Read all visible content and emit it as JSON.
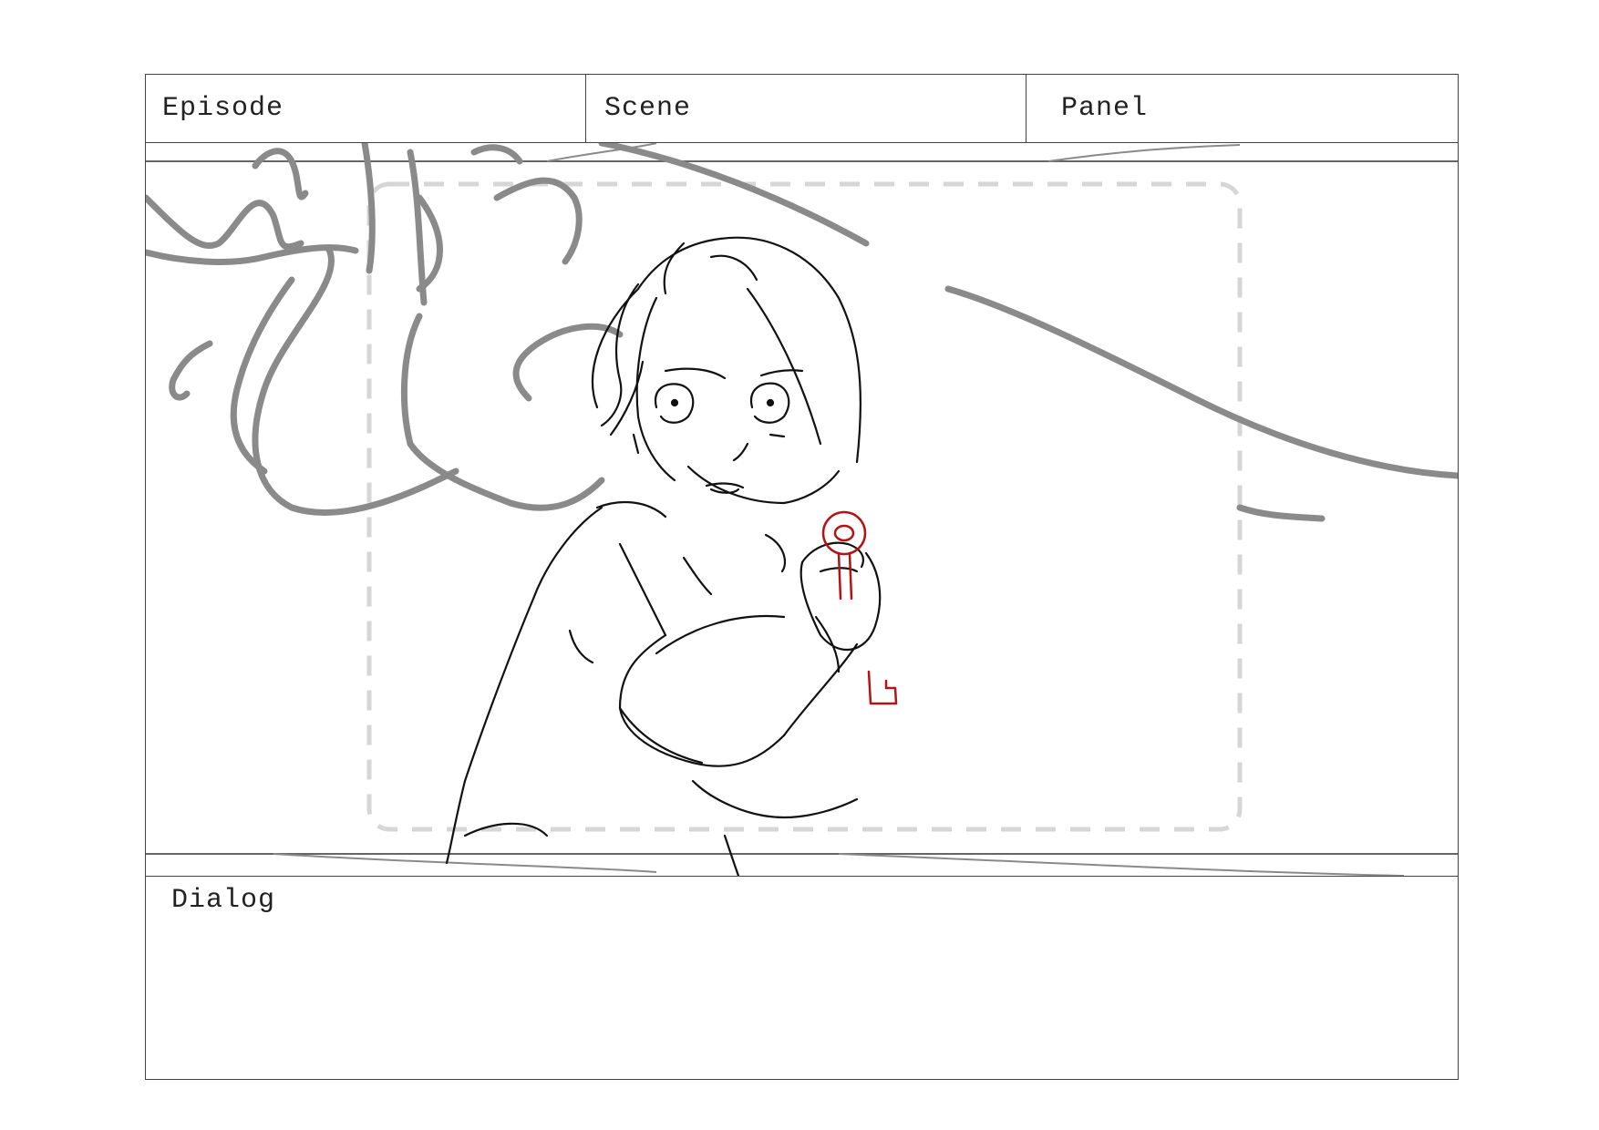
{
  "header": {
    "episode_label": "Episode",
    "scene_label": "Scene",
    "panel_label": "Panel"
  },
  "dialog": {
    "label": "Dialog"
  },
  "colors": {
    "border": "#444444",
    "sketch_line": "#111111",
    "background_sketch": "#8a8a8a",
    "safe_area": "#d6d6d6",
    "key_prop": "#b31313"
  },
  "frame": {
    "drawing": "storyboard-sketch"
  }
}
